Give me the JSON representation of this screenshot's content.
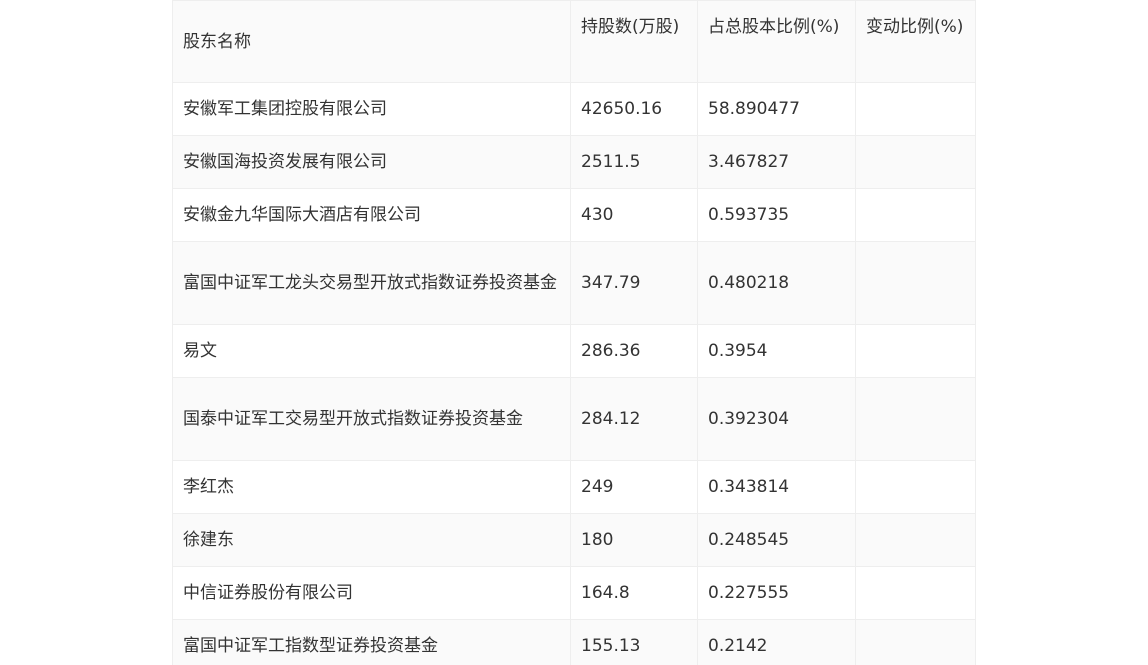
{
  "table": {
    "headers": [
      "股东名称",
      "持股数(万股)",
      "占总股本比例(%)",
      "变动比例(%)"
    ],
    "rows": [
      [
        "安徽军工集团控股有限公司",
        "42650.16",
        "58.890477",
        ""
      ],
      [
        "安徽国海投资发展有限公司",
        "2511.5",
        "3.467827",
        ""
      ],
      [
        "安徽金九华国际大酒店有限公司",
        "430",
        "0.593735",
        ""
      ],
      [
        "富国中证军工龙头交易型开放式指数证券投资基金",
        "347.79",
        "0.480218",
        ""
      ],
      [
        "易文",
        "286.36",
        "0.3954",
        ""
      ],
      [
        "国泰中证军工交易型开放式指数证券投资基金",
        "284.12",
        "0.392304",
        ""
      ],
      [
        "李红杰",
        "249",
        "0.343814",
        ""
      ],
      [
        "徐建东",
        "180",
        "0.248545",
        ""
      ],
      [
        "中信证券股份有限公司",
        "164.8",
        "0.227555",
        ""
      ],
      [
        "富国中证军工指数型证券投资基金",
        "155.13",
        "0.2142",
        ""
      ]
    ]
  }
}
